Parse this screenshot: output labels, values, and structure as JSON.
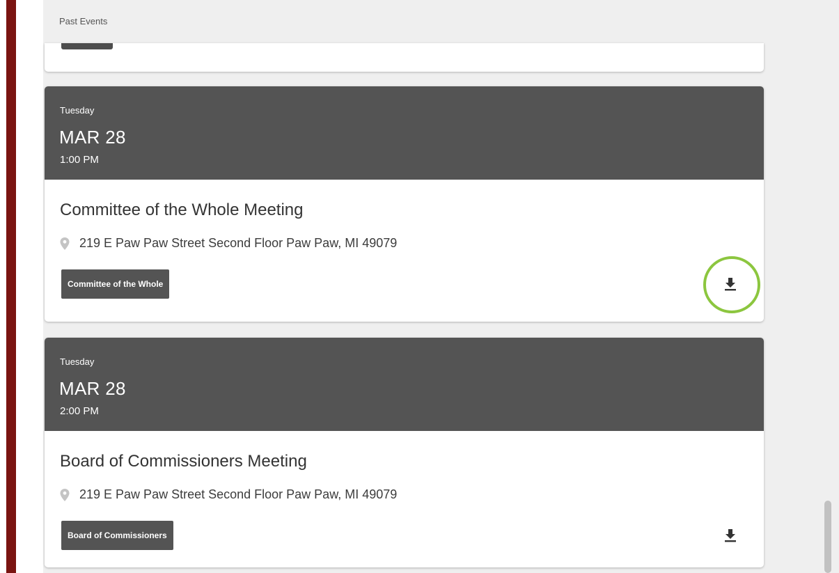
{
  "section_label": "Past Events",
  "events": [
    {
      "day": "Tuesday",
      "date": "MAR 28",
      "time": "1:00 PM",
      "title": "Committee of the Whole Meeting",
      "location": "219 E Paw Paw Street Second Floor Paw Paw, MI 49079",
      "tag": "Committee of the Whole",
      "download_icon": "download-icon",
      "highlighted": true
    },
    {
      "day": "Tuesday",
      "date": "MAR 28",
      "time": "2:00 PM",
      "title": "Board of Commissioners Meeting",
      "location": "219 E Paw Paw Street Second Floor Paw Paw, MI 49079",
      "tag": "Board of Commissioners",
      "download_icon": "download-icon",
      "highlighted": false
    }
  ],
  "colors": {
    "header_bg": "#545454",
    "accent_bar": "#7a1411",
    "highlight_ring": "#8cc63f",
    "panel_bg": "#efefef"
  }
}
